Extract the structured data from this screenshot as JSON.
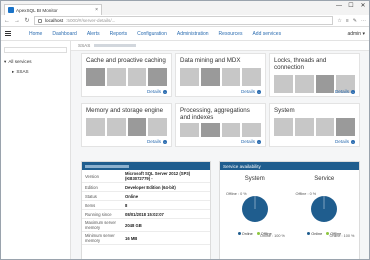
{
  "browser": {
    "tab_title": "ApexSQL BI Monitor",
    "tab_close": "×",
    "window_controls": [
      "—",
      "☐",
      "✕"
    ],
    "url_host": "localhost",
    "url_path": ":5000/#/server-details/...",
    "nav_back": "←",
    "nav_forward": "→",
    "nav_refresh": "↻",
    "right_icons": [
      "☆",
      "≡",
      "✎",
      "⋯"
    ]
  },
  "app": {
    "menu": [
      "Home",
      "Dashboard",
      "Alerts",
      "Reports",
      "Configuration",
      "Administration",
      "Resources",
      "Add services"
    ],
    "user": "admin ▾"
  },
  "sidebar": {
    "root_label": "All services",
    "root_toggle": "▾",
    "child_label": "SSAS",
    "child_toggle": "▸"
  },
  "breadcrumb": {
    "label": "SSAS"
  },
  "cards": [
    {
      "title": "Cache and proactive caching",
      "details": "Details"
    },
    {
      "title": "Data mining and MDX",
      "details": "Details"
    },
    {
      "title": "Locks, threads and connection",
      "details": "Details"
    },
    {
      "title": "Memory and storage engine",
      "details": "Details"
    },
    {
      "title": "Processing, aggregations and indexes",
      "details": "Details"
    },
    {
      "title": "System",
      "details": "Details"
    }
  ],
  "server_info": {
    "rows": [
      {
        "k": "Version",
        "v": "Microsoft SQL Server 2012 (SP3) (KB3072779) -"
      },
      {
        "k": "Edition",
        "v": "Developer Edition (64-bit)"
      },
      {
        "k": "Status",
        "v": "Online"
      },
      {
        "k": "Items",
        "v": "8"
      },
      {
        "k": "Running since",
        "v": "08/01/2018 15:02:07"
      },
      {
        "k": "Maximum server memory",
        "v": "2048 GB"
      },
      {
        "k": "Minimum server memory",
        "v": "16 MB"
      }
    ]
  },
  "availability": {
    "header": "Service availability",
    "charts": [
      {
        "title": "System",
        "offline_label": "Offline : 0 %",
        "online_label": "Online : 100 %",
        "online": 100,
        "offline": 0
      },
      {
        "title": "Service",
        "offline_label": "Offline : 0 %",
        "online_label": "Online : 100 %",
        "online": 100,
        "offline": 0
      }
    ],
    "legend": [
      "Online",
      "Offline"
    ],
    "colors": {
      "online": "#1f5d8e",
      "offline": "#8dc63f"
    }
  }
}
